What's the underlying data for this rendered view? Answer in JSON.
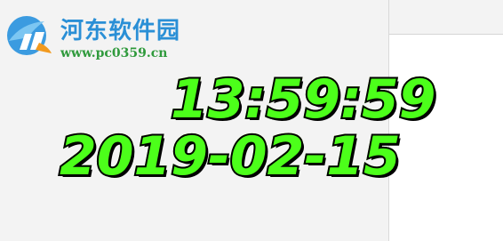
{
  "watermark": {
    "site_name": "河东软件园",
    "url": "www.pc0359.cn"
  },
  "clock": {
    "time": "13:59:59",
    "date": "2019-02-15",
    "digit_color": "#4cff1a",
    "outline_color": "#000000"
  },
  "colors": {
    "background": "#f3f3f3",
    "panel": "#ffffff",
    "brand_blue": "#2a8fd6",
    "brand_green": "#2f9a3c",
    "brand_orange": "#f29a1f"
  }
}
